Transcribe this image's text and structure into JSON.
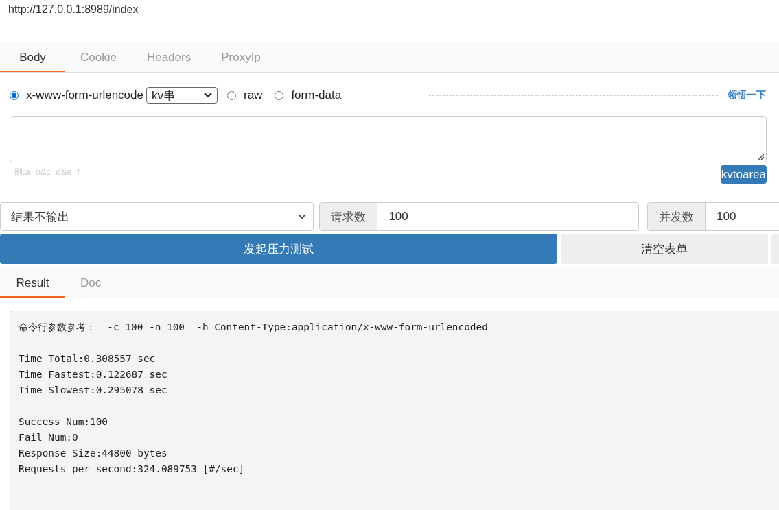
{
  "url": "http://127.0.0.1:8989/index",
  "request_tabs": [
    {
      "label": "Body",
      "selected": true
    },
    {
      "label": "Cookie",
      "selected": false
    },
    {
      "label": "Headers",
      "selected": false
    },
    {
      "label": "ProxyIp",
      "selected": false
    }
  ],
  "body_types": [
    {
      "label": "x-www-form-urlencode",
      "selected": true,
      "select_value": "kv串"
    },
    {
      "label": "raw",
      "selected": false
    },
    {
      "label": "form-data",
      "selected": false
    }
  ],
  "hint_link": "领悟一下",
  "body_field": {
    "placeholder": "例:a=b&c=d&e=f"
  },
  "kvtoarea_button": "kvtoarea",
  "output_mode": "结果不输出",
  "requests": {
    "label": "请求数",
    "value": "100"
  },
  "concurrency": {
    "label": "并发数",
    "value": "100"
  },
  "start_button": "发起压力测试",
  "clear_button": "清空表单",
  "result_tabs": [
    {
      "label": "Result",
      "selected": true
    },
    {
      "label": "Doc",
      "selected": false
    }
  ],
  "output_blocks": [
    [
      "命令行参数参考：  -c 100 -n 100  -h Content-Type:application/x-www-form-urlencoded"
    ],
    [
      "Time Total:0.308557 sec",
      "Time Fastest:0.122687 sec",
      "Time Slowest:0.295078 sec"
    ],
    [
      "Success Num:100",
      "Fail Num:0",
      "Response Size:44800 bytes",
      "Requests per second:324.089753 [#/sec]"
    ]
  ]
}
